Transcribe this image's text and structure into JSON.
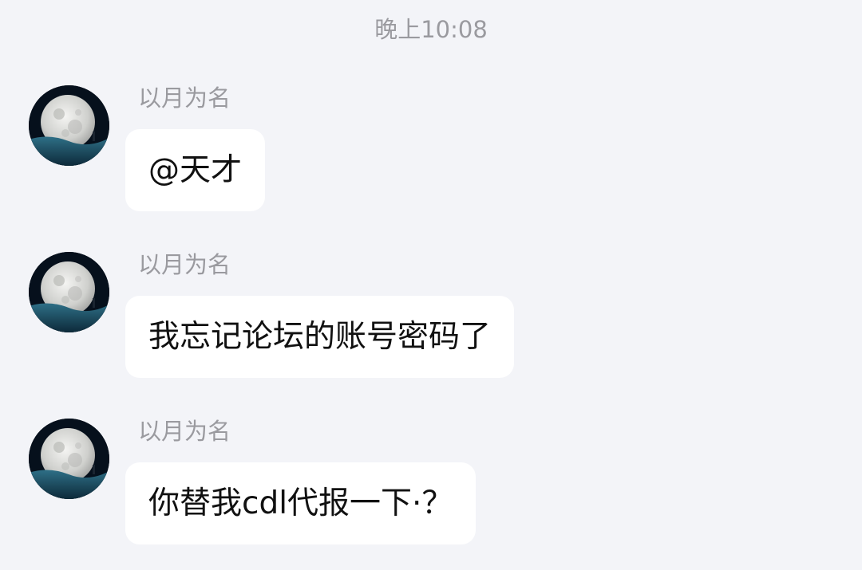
{
  "timestamp": "晚上10:08",
  "messages": [
    {
      "sender": "以月为名",
      "text": "@天才",
      "avatar_icon": "moon-avatar-icon"
    },
    {
      "sender": "以月为名",
      "text": "我忘记论坛的账号密码了",
      "avatar_icon": "moon-avatar-icon"
    },
    {
      "sender": "以月为名",
      "text": "你替我cdl代报一下·？",
      "avatar_icon": "moon-avatar-icon"
    }
  ],
  "colors": {
    "background": "#f3f4f8",
    "bubble": "#ffffff",
    "meta_text": "#9a9a9f",
    "message_text": "#111111"
  }
}
